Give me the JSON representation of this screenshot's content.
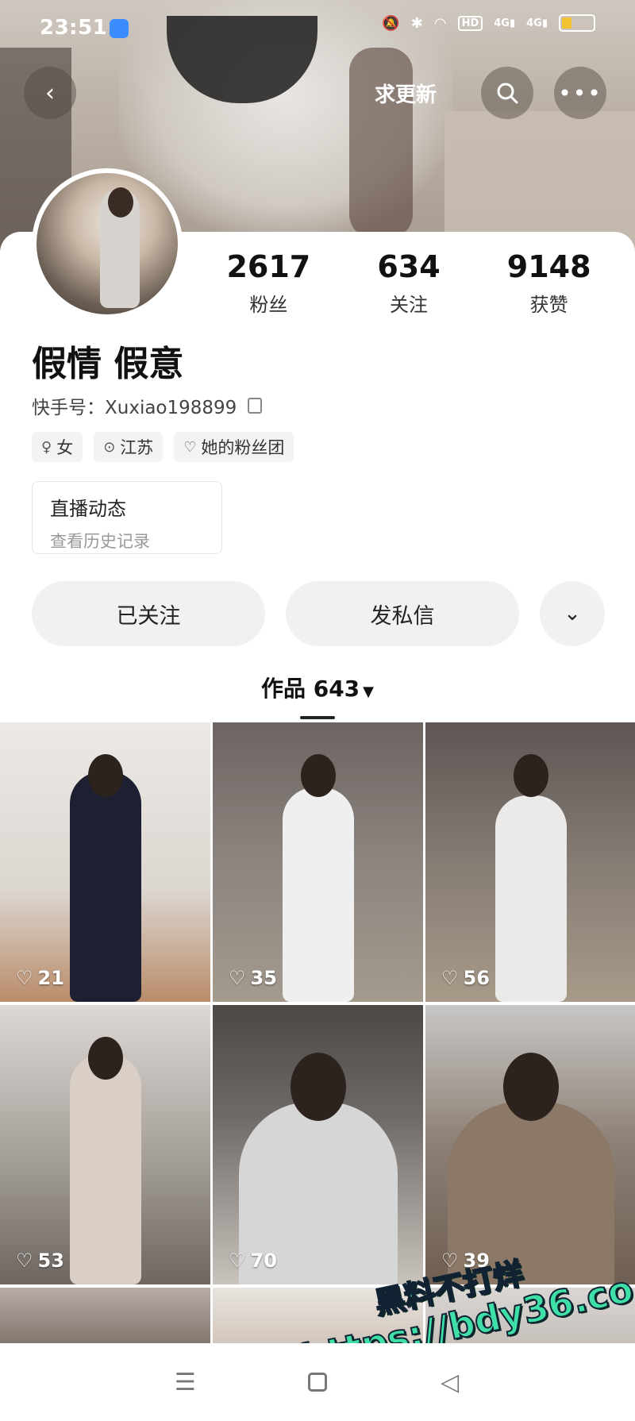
{
  "status_bar": {
    "time": "23:51",
    "icons": [
      "mute-icon",
      "bluetooth-icon",
      "wifi-icon",
      "hd-icon",
      "signal-4g-icon",
      "signal-4g-icon",
      "battery-icon"
    ],
    "battery_color": "#f2c230"
  },
  "top_nav": {
    "back_icon": "chevron-left-icon",
    "update_label": "求更新",
    "search_icon": "search-icon",
    "more_icon": "more-dots-icon"
  },
  "profile": {
    "name": "假情 假意",
    "kwai_id": "快手号：Xuxiao198899",
    "stats": [
      {
        "value": "2617",
        "label": "粉丝"
      },
      {
        "value": "634",
        "label": "关注"
      },
      {
        "value": "9148",
        "label": "获赞"
      }
    ],
    "tags": [
      {
        "icon": "female-icon",
        "label": "女"
      },
      {
        "icon": "location-icon",
        "label": "江苏"
      },
      {
        "icon": "fan-club-icon",
        "label": "她的粉丝团"
      }
    ],
    "live": {
      "title": "直播动态",
      "subtitle": "查看历史记录"
    }
  },
  "actions": {
    "follow_label": "已关注",
    "message_label": "发私信",
    "more_icon": "chevron-down-icon"
  },
  "works": {
    "label": "作品 643",
    "items": [
      {
        "likes": "21"
      },
      {
        "likes": "35"
      },
      {
        "likes": "56"
      },
      {
        "likes": "53"
      },
      {
        "likes": "70"
      },
      {
        "likes": "39"
      }
    ]
  },
  "watermark": {
    "line1": "黑料不打烊",
    "line2": "https://bdy36.co"
  },
  "bottom_nav": {
    "items": [
      "menu-icon",
      "home-square-icon",
      "back-triangle-icon"
    ]
  }
}
